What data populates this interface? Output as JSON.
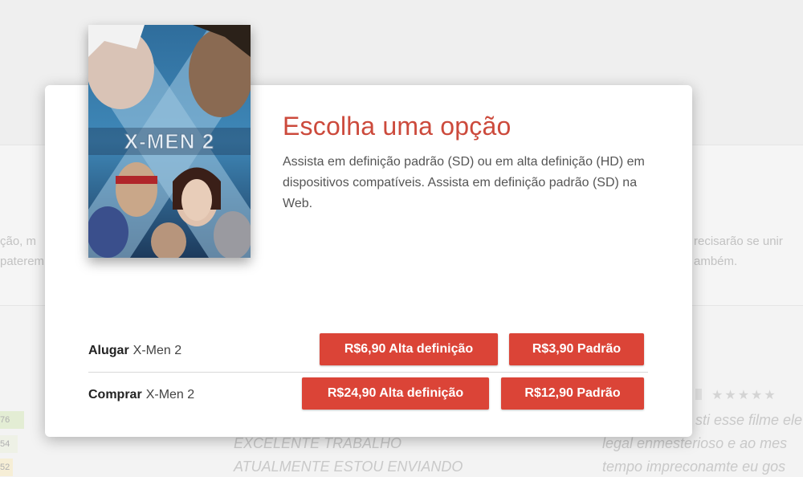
{
  "background": {
    "left_text_1": "ção, m",
    "left_text_2": "paterem",
    "right_text_1": "recisarão se unir",
    "right_text_2": "ambém.",
    "review_left_1": "EXCELENTE TRABALHO",
    "review_left_2": "ATUALMENTE ESTOU ENVIANDO",
    "review_right_1": "sti esse filme ele",
    "review_right_2": "legal enmesterioso e ao mes",
    "review_right_3": "tempo impreconamte eu gos",
    "counts": [
      "76",
      "54",
      "52"
    ],
    "stars": "★★★★★"
  },
  "poster": {
    "title_text": "X-MEN 2"
  },
  "dialog": {
    "title": "Escolha uma opção",
    "description": "Assista em definição padrão (SD) ou em alta definição (HD) em dispositivos compatíveis. Assista em definição padrão (SD) na Web."
  },
  "rent": {
    "action": "Alugar",
    "movie": "X-Men 2",
    "hd_button": "R$6,90 Alta definição",
    "sd_button": "R$3,90 Padrão"
  },
  "buy": {
    "action": "Comprar",
    "movie": "X-Men 2",
    "hd_button": "R$24,90 Alta definição",
    "sd_button": "R$12,90 Padrão"
  },
  "colors": {
    "accent": "#db4437",
    "title": "#cc4a3c"
  }
}
